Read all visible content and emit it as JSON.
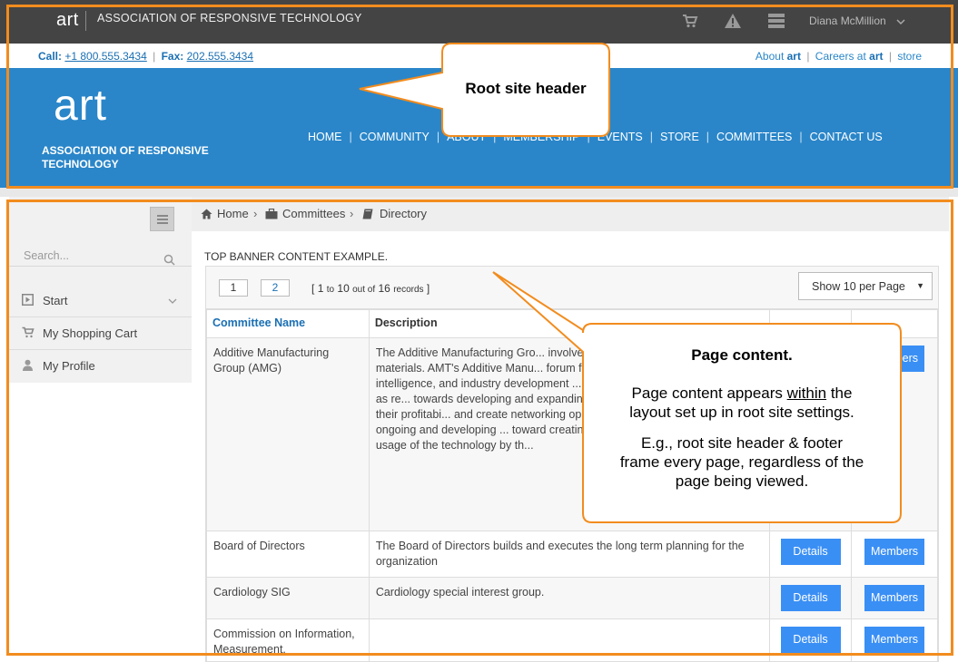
{
  "topbar": {
    "logo": "art",
    "org_name": "ASSOCIATION OF RESPONSIVE TECHNOLOGY",
    "user_name": "Diana McMillion"
  },
  "contact": {
    "call_label": "Call:",
    "phone": "+1 800.555.3434",
    "fax_label": "Fax:",
    "fax": "202.555.3434",
    "about_prefix": "About",
    "about_brand": "art",
    "careers_prefix": "Careers at",
    "careers_brand": "art",
    "store": "store"
  },
  "header": {
    "logo": "art",
    "org_title": "ASSOCIATION OF RESPONSIVE TECHNOLOGY",
    "nav": [
      "HOME",
      "COMMUNITY",
      "ABOUT",
      "MEMBERSHIP",
      "EVENTS",
      "STORE",
      "COMMITTEES",
      "CONTACT US"
    ],
    "nav_separator": "|"
  },
  "sidebar": {
    "search_placeholder": "Search...",
    "items": [
      {
        "label": "Start"
      },
      {
        "label": "My Shopping Cart"
      },
      {
        "label": "My Profile"
      }
    ]
  },
  "breadcrumb": {
    "home": "Home",
    "committees": "Committees",
    "directory": "Directory",
    "separator": "›"
  },
  "banner": "TOP BANNER CONTENT EXAMPLE.",
  "pager": {
    "page1": "1",
    "page2": "2",
    "open_bracket": "[",
    "start": "1",
    "to": "to",
    "end": "10",
    "out_of": "out of",
    "total": "16",
    "records_word": "records",
    "close_bracket": "]",
    "per_page": "Show 10 per Page"
  },
  "table": {
    "col_name": "Committee Name",
    "col_desc": "Description",
    "details_label": "Details",
    "members_label": "Members",
    "rows": [
      {
        "name": "Additive Manufacturing Group (AMG)",
        "desc": "The Additive Manufacturing Gro... involved with building and selling ... and materials. AMT's Additive Manu... forum for member companies conce... intelligence, and industry development ... concerns on export control issues as re... towards developing and expanding ser... its members, enhancing their profitabi... and create networking opportunities; a... overviews of ongoing and developing ... toward creating greater visibility for th... increased usage of the technology by th..."
      },
      {
        "name": "Board of Directors",
        "desc": "The Board of Directors builds and executes the long term planning for the organization"
      },
      {
        "name": "Cardiology SIG",
        "desc": "Cardiology special interest group."
      },
      {
        "name": "Commission on Information, Measurement,",
        "desc": ""
      }
    ]
  },
  "callouts": {
    "header_label": "Root site header",
    "content_title": "Page content.",
    "content_line1_pre": "Page content appears ",
    "content_line1_u": "within",
    "content_line1_post": " the",
    "content_line2": "layout set up in root site settings.",
    "content_line3": "E.g., root site header & footer",
    "content_line4": "frame every page, regardless of the",
    "content_line5": "page being viewed."
  },
  "colors": {
    "header_blue": "#2a86c9",
    "topbar_gray": "#444444",
    "button_blue": "#3a8ff5",
    "frame_orange": "#f28c1e",
    "link_blue": "#1a6fb3"
  }
}
